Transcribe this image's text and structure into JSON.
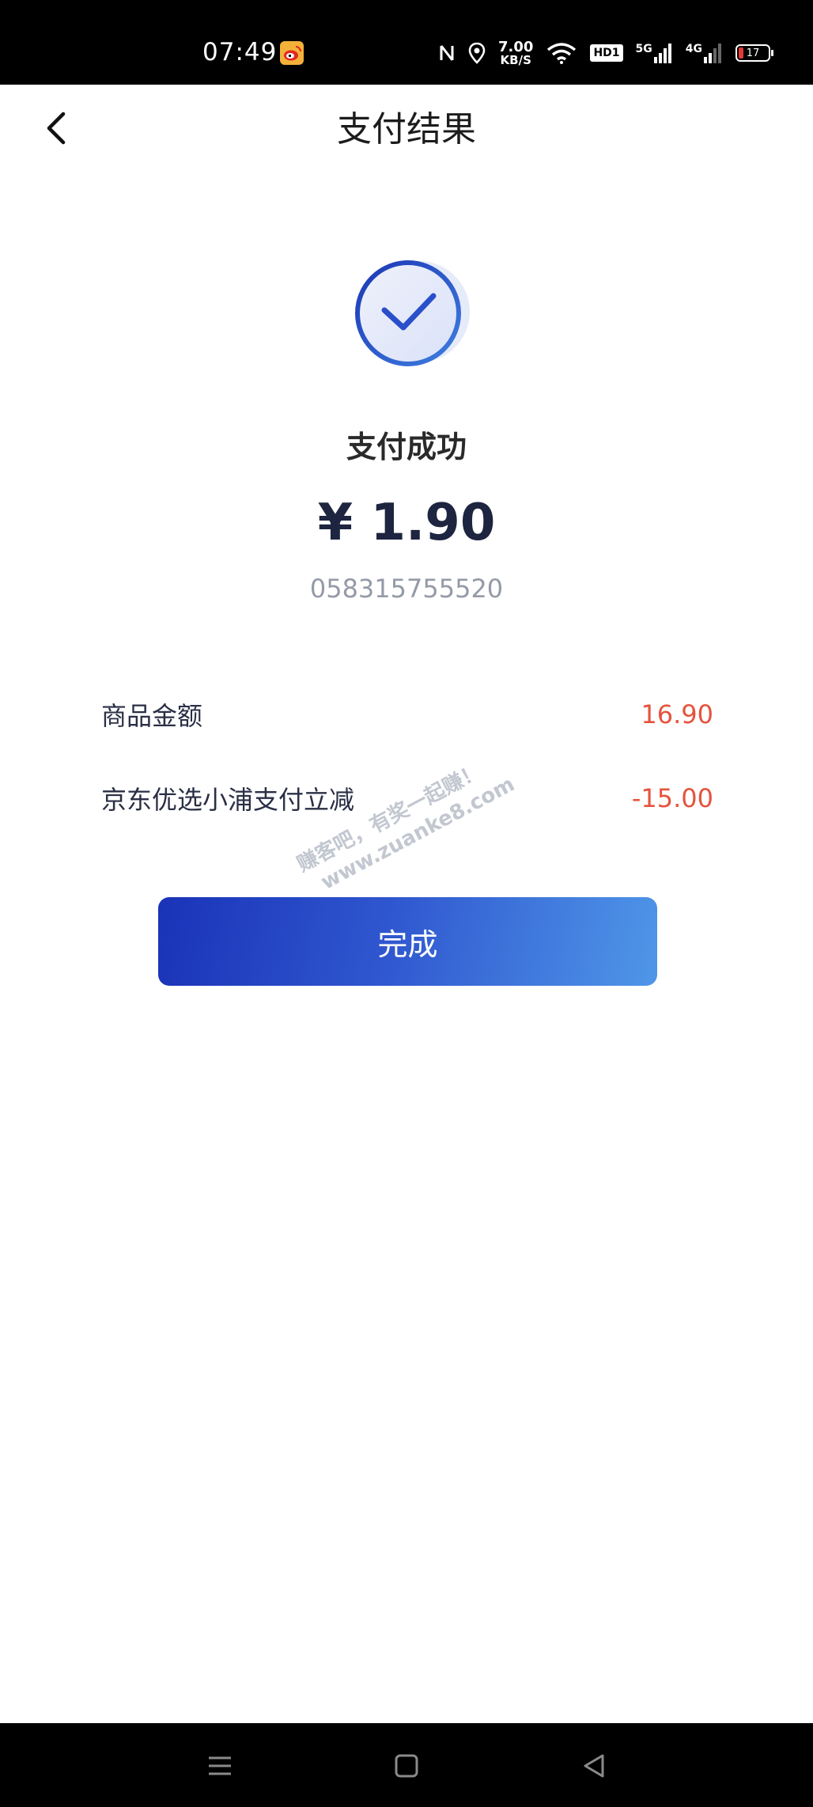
{
  "status_bar": {
    "time": "07:49",
    "speed_value": "7.00",
    "speed_unit": "KB/S",
    "hd_label": "HD1",
    "signal_1_label": "5G",
    "signal_2_label": "4G",
    "battery_level": "17",
    "battery_fraction": 0.17,
    "weibo_icon": "weibo-icon",
    "battery_color": "#e53935"
  },
  "header": {
    "title": "支付结果",
    "back_icon": "chevron-left-icon"
  },
  "result": {
    "icon": "check-circle-icon",
    "status": "支付成功",
    "amount": "¥ 1.90",
    "order_number": "058315755520"
  },
  "details": [
    {
      "label": "商品金额",
      "value": "16.90"
    },
    {
      "label": "京东优选小浦支付立减",
      "value": "-15.00"
    }
  ],
  "actions": {
    "done_label": "完成"
  },
  "watermark": {
    "line1": "赚客吧，有奖一起赚！",
    "line2": "www.zuanke8.com"
  },
  "nav_bar": {
    "menu_icon": "menu-icon",
    "home_icon": "square-icon",
    "back_icon": "triangle-back-icon"
  },
  "colors": {
    "accent_blue": "#2f56cf",
    "amount_text": "#1d2540",
    "value_red": "#e5533d"
  }
}
